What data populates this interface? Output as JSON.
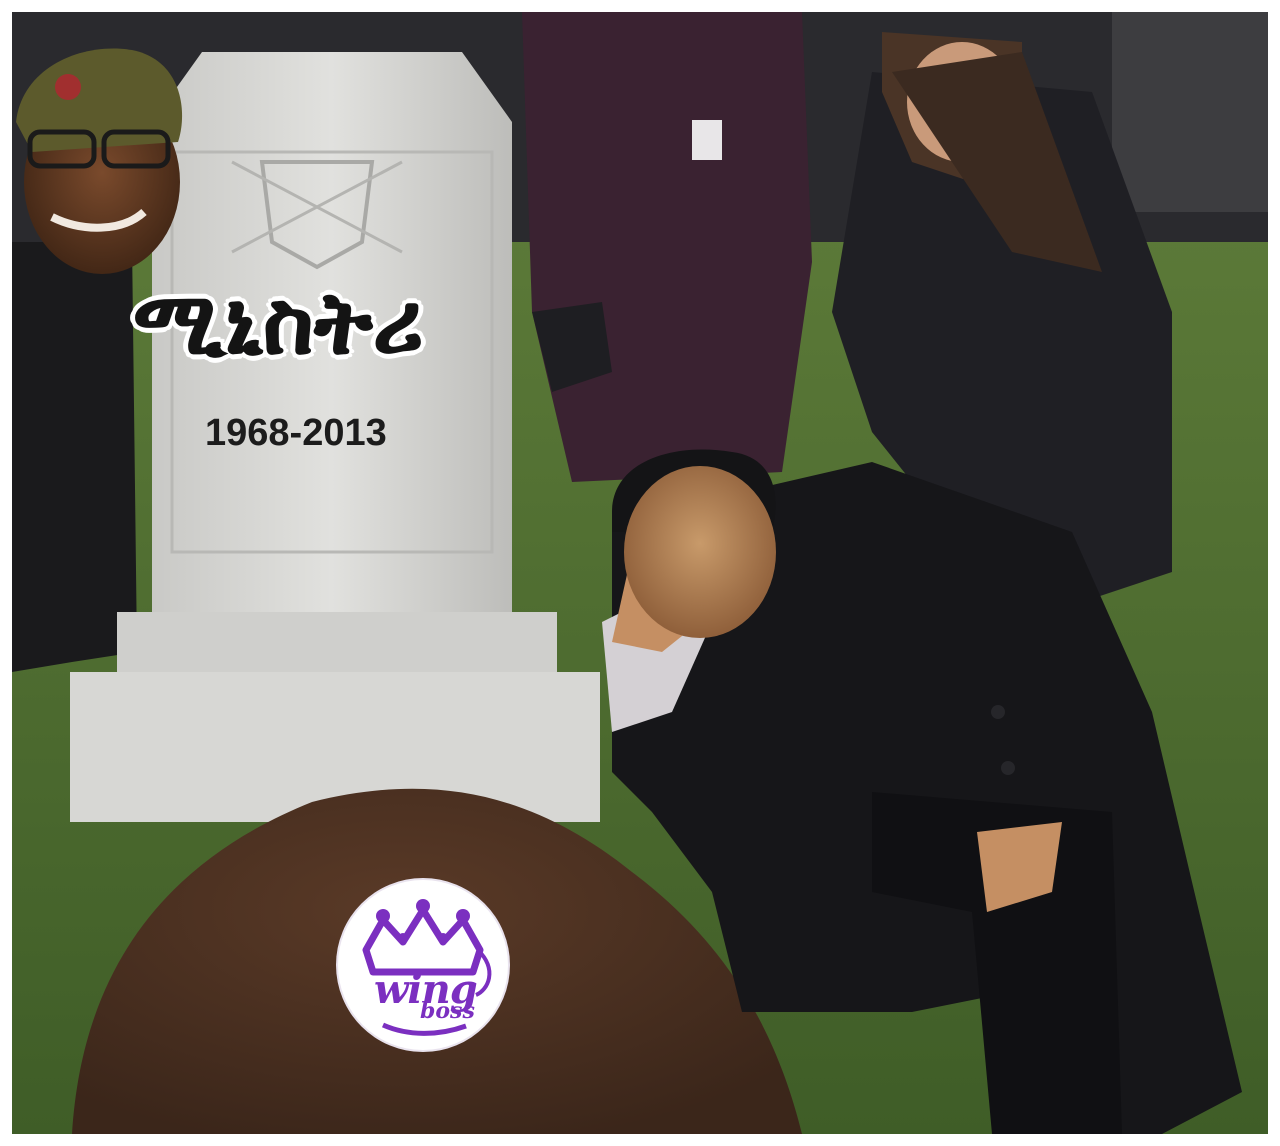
{
  "meme": {
    "headline": "ሚኒስትሪ",
    "years": "1968-2013"
  },
  "logo": {
    "word": "wing",
    "sub": "boss"
  },
  "colors": {
    "grass": "#4f6f32",
    "soil": "#4a3022",
    "stone": "#d9d9d6",
    "coat": "#1b1b1f",
    "jacket": "#3a2231",
    "logo_purple": "#7b2fc0"
  }
}
